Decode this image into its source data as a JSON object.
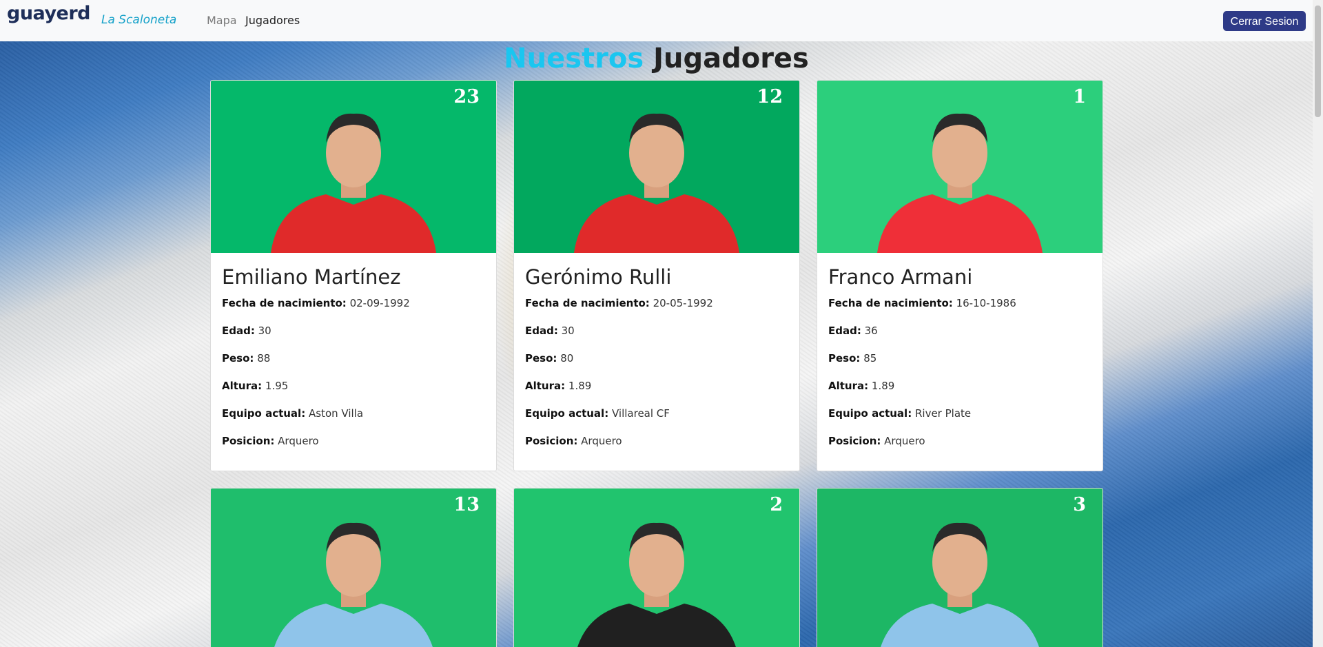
{
  "navbar": {
    "logo": "guayerd",
    "brand": "La Scaloneta",
    "links": [
      "Mapa",
      "Jugadores"
    ],
    "logout_label": "Cerrar Sesion"
  },
  "page": {
    "title_accent": "Nuestros",
    "title_rest": "Jugadores"
  },
  "labels": {
    "birth": "Fecha de nacimiento:",
    "age": "Edad:",
    "weight": "Peso:",
    "height": "Altura:",
    "team": "Equipo actual:",
    "position": "Posicion:"
  },
  "players": [
    {
      "number": "23",
      "name": "Emiliano Martínez",
      "birth": "02-09-1992",
      "age": "30",
      "weight": "88",
      "height": "1.95",
      "team": "Aston Villa",
      "position": "Arquero",
      "bg": "#05b86a",
      "shirt": "#e02a2a"
    },
    {
      "number": "12",
      "name": "Gerónimo Rulli",
      "birth": "20-05-1992",
      "age": "30",
      "weight": "80",
      "height": "1.89",
      "team": "Villareal CF",
      "position": "Arquero",
      "bg": "#02a85e",
      "shirt": "#e02a2a"
    },
    {
      "number": "1",
      "name": "Franco Armani",
      "birth": "16-10-1986",
      "age": "36",
      "weight": "85",
      "height": "1.89",
      "team": "River Plate",
      "position": "Arquero",
      "bg": "#2ccf7c",
      "shirt": "#ef2f38"
    },
    {
      "number": "13",
      "name": "",
      "bg": "#1fbe6c",
      "shirt": "#8fc4ea"
    },
    {
      "number": "2",
      "name": "",
      "bg": "#21c46e",
      "shirt": "#202020"
    },
    {
      "number": "3",
      "name": "",
      "bg": "#1db765",
      "shirt": "#8fc4ea"
    }
  ]
}
